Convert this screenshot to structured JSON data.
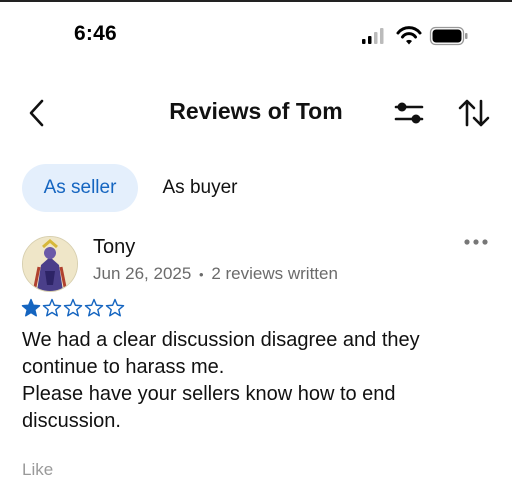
{
  "status_bar": {
    "time": "6:46"
  },
  "header": {
    "title": "Reviews of Tom",
    "back_icon": "chevron-left-icon",
    "filter_icon": "sliders-icon",
    "sort_icon": "sort-arrows-icon"
  },
  "tabs": [
    {
      "label": "As seller",
      "selected": true
    },
    {
      "label": "As buyer",
      "selected": false
    }
  ],
  "review": {
    "reviewer": "Tony",
    "date": "Jun 26, 2025",
    "separator": "•",
    "reviews_written": "2 reviews written",
    "rating": 1,
    "rating_max": 5,
    "lines": [
      "We had a clear discussion disagree and they",
      "continue to harass me.",
      "Please have your sellers know how to end",
      "discussion."
    ],
    "like_label": "Like"
  },
  "colors": {
    "accent": "#1565c0",
    "tab_bg": "#e4effc",
    "meta_text": "#6b6b6b",
    "muted": "#9a9a9a",
    "star": "#1565c0"
  }
}
